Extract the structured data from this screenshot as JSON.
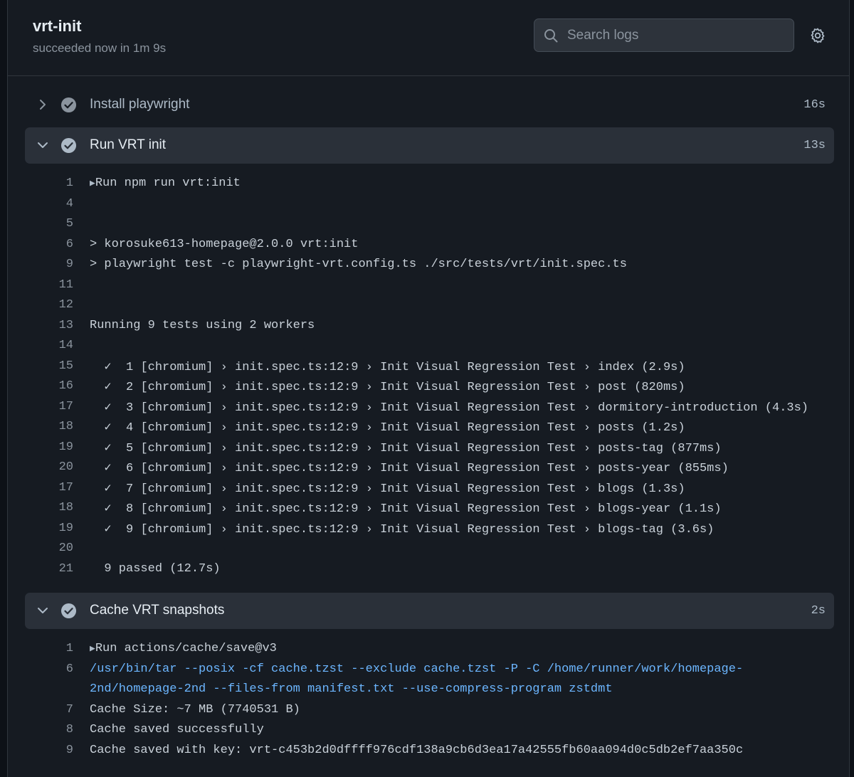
{
  "job": {
    "title": "vrt-init",
    "status": "succeeded now in 1m 9s"
  },
  "search": {
    "placeholder": "Search logs",
    "value": ""
  },
  "icons": {
    "search": "search-icon",
    "settings": "gear-icon",
    "collapsed": "chevron-right-icon",
    "expanded": "chevron-down-icon",
    "success": "check-circle-icon"
  },
  "colors": {
    "background": "#161b22",
    "success_icon": "#8b949e",
    "command_text": "#6cb6ff"
  },
  "steps": [
    {
      "name": "Install playwright",
      "duration": "16s",
      "expanded": false,
      "lines": []
    },
    {
      "name": "Run VRT init",
      "duration": "13s",
      "expanded": true,
      "lines": [
        {
          "n": "1",
          "text": "Run npm run vrt:init",
          "group": true
        },
        {
          "n": "4",
          "text": ""
        },
        {
          "n": "5",
          "text": ""
        },
        {
          "n": "6",
          "text": "> korosuke613-homepage@2.0.0 vrt:init"
        },
        {
          "n": "9",
          "text": "> playwright test -c playwright-vrt.config.ts ./src/tests/vrt/init.spec.ts"
        },
        {
          "n": "11",
          "text": ""
        },
        {
          "n": "12",
          "text": ""
        },
        {
          "n": "13",
          "text": "Running 9 tests using 2 workers"
        },
        {
          "n": "14",
          "text": ""
        },
        {
          "n": "15",
          "text": "  ✓  1 [chromium] › init.spec.ts:12:9 › Init Visual Regression Test › index (2.9s)"
        },
        {
          "n": "16",
          "text": "  ✓  2 [chromium] › init.spec.ts:12:9 › Init Visual Regression Test › post (820ms)"
        },
        {
          "n": "17",
          "text": "  ✓  3 [chromium] › init.spec.ts:12:9 › Init Visual Regression Test › dormitory-introduction (4.3s)"
        },
        {
          "n": "18",
          "text": "  ✓  4 [chromium] › init.spec.ts:12:9 › Init Visual Regression Test › posts (1.2s)"
        },
        {
          "n": "19",
          "text": "  ✓  5 [chromium] › init.spec.ts:12:9 › Init Visual Regression Test › posts-tag (877ms)"
        },
        {
          "n": "20",
          "text": "  ✓  6 [chromium] › init.spec.ts:12:9 › Init Visual Regression Test › posts-year (855ms)"
        },
        {
          "n": "17",
          "text": "  ✓  7 [chromium] › init.spec.ts:12:9 › Init Visual Regression Test › blogs (1.3s)"
        },
        {
          "n": "18",
          "text": "  ✓  8 [chromium] › init.spec.ts:12:9 › Init Visual Regression Test › blogs-year (1.1s)"
        },
        {
          "n": "19",
          "text": "  ✓  9 [chromium] › init.spec.ts:12:9 › Init Visual Regression Test › blogs-tag (3.6s)"
        },
        {
          "n": "20",
          "text": ""
        },
        {
          "n": "21",
          "text": "  9 passed (12.7s)"
        }
      ]
    },
    {
      "name": "Cache VRT snapshots",
      "duration": "2s",
      "expanded": true,
      "lines": [
        {
          "n": "1",
          "text": "Run actions/cache/save@v3",
          "group": true
        },
        {
          "n": "6",
          "text": "/usr/bin/tar --posix -cf cache.tzst --exclude cache.tzst -P -C /home/runner/work/homepage-",
          "cmd": true
        },
        {
          "n": "",
          "text": "2nd/homepage-2nd --files-from manifest.txt --use-compress-program zstdmt",
          "cmd": true
        },
        {
          "n": "7",
          "text": "Cache Size: ~7 MB (7740531 B)"
        },
        {
          "n": "8",
          "text": "Cache saved successfully"
        },
        {
          "n": "9",
          "text": "Cache saved with key: vrt-c453b2d0dffff976cdf138a9cb6d3ea17a42555fb60aa094d0c5db2ef7aa350c"
        }
      ]
    }
  ]
}
